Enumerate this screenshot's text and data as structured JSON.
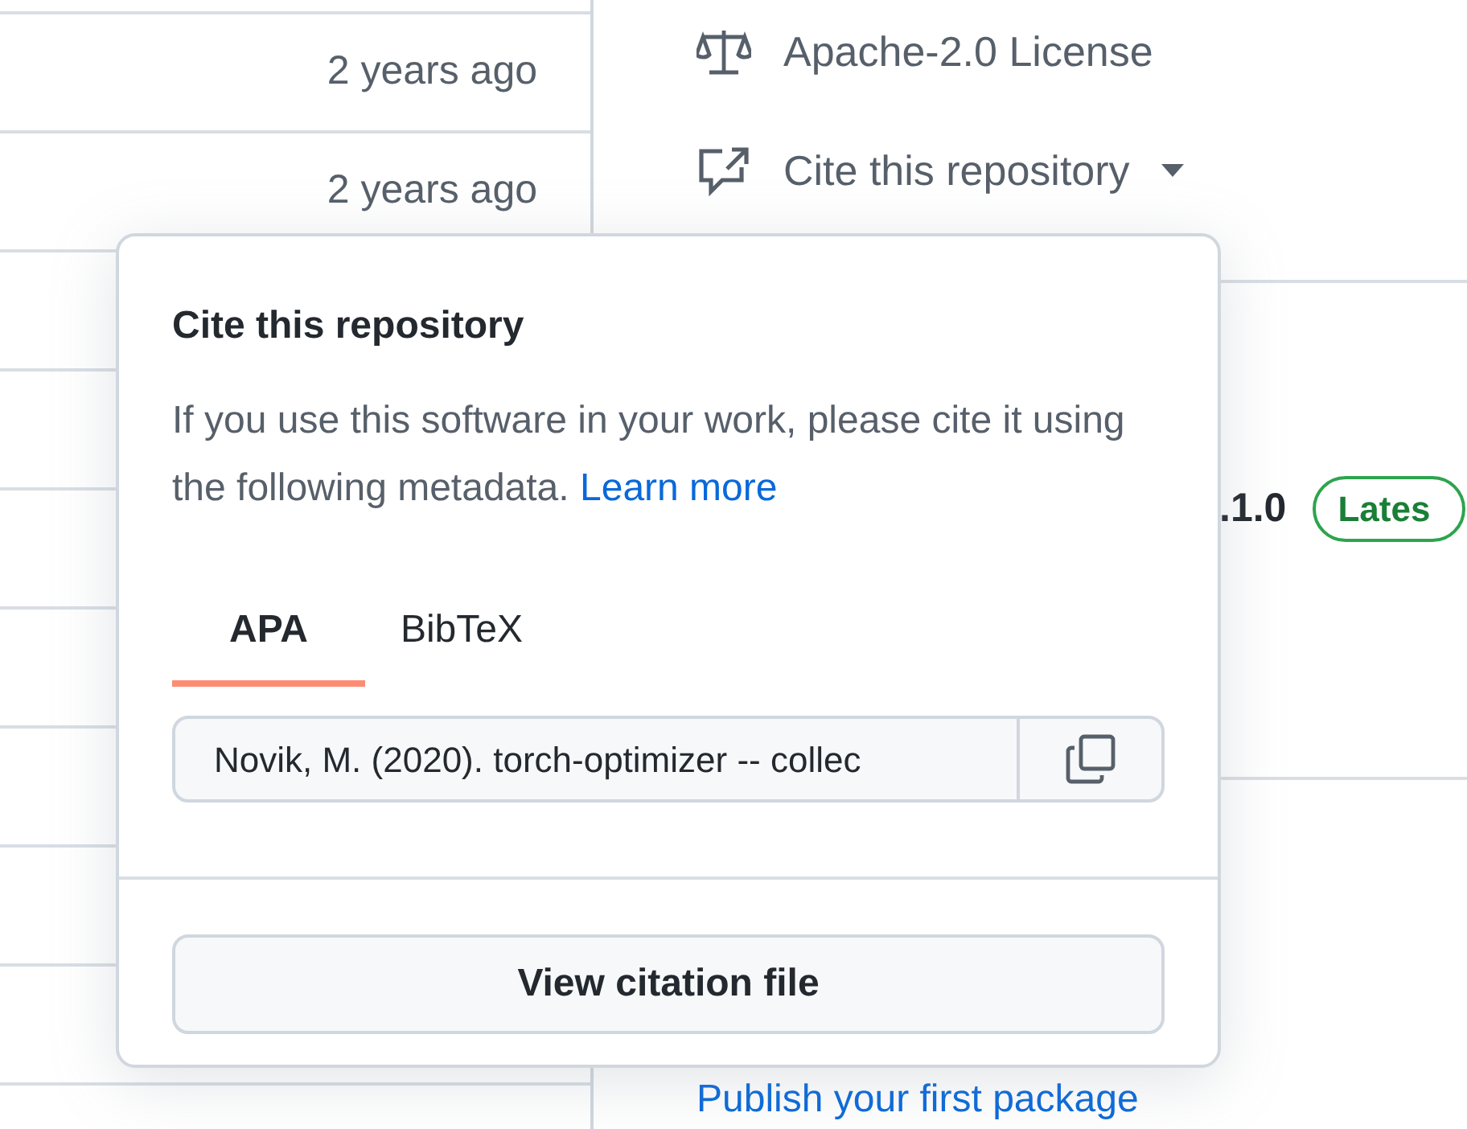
{
  "files": {
    "rows": [
      {
        "age": "2 years ago"
      },
      {
        "age": "2 years ago"
      }
    ]
  },
  "sidebar": {
    "license": "Apache-2.0 License",
    "cite_button": "Cite this repository",
    "release_version": ".1.0",
    "release_badge": "Lates",
    "publish_link": "Publish your first package"
  },
  "cite_popover": {
    "title": "Cite this repository",
    "description": "If you use this software in your work, please cite it using the following metadata.",
    "learn_more": "Learn more",
    "tabs": [
      {
        "label": "APA",
        "selected": true
      },
      {
        "label": "BibTeX",
        "selected": false
      }
    ],
    "citation": "Novik, M. (2020). torch-optimizer -- collec",
    "view_button": "View citation file"
  }
}
